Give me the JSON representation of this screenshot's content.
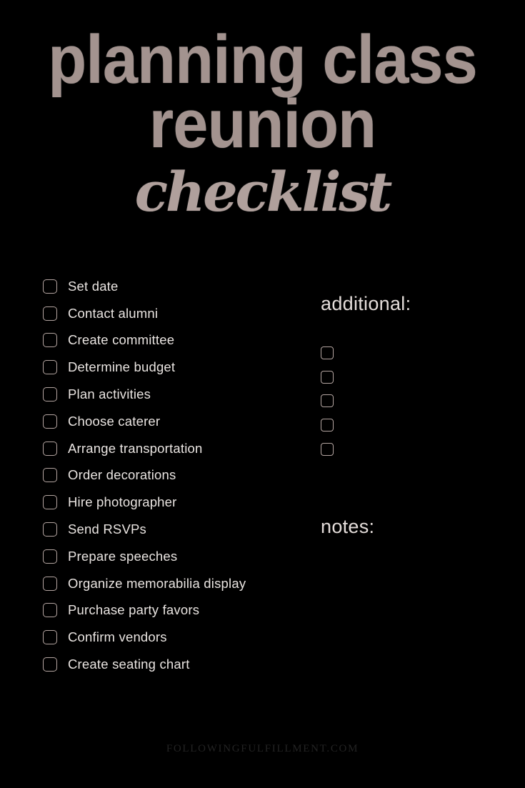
{
  "background_color": "#000000",
  "accent_color": "#a3938f",
  "header": {
    "title_line_1": "planning class",
    "title_line_2": "reunion",
    "script_word": "checklist"
  },
  "checklist": {
    "items": [
      {
        "label": "Set date",
        "checked": false
      },
      {
        "label": "Contact alumni",
        "checked": false
      },
      {
        "label": "Create committee",
        "checked": false
      },
      {
        "label": "Determine budget",
        "checked": false
      },
      {
        "label": "Plan activities",
        "checked": false
      },
      {
        "label": "Choose caterer",
        "checked": false
      },
      {
        "label": "Arrange transportation",
        "checked": false
      },
      {
        "label": "Order decorations",
        "checked": false
      },
      {
        "label": "Hire photographer",
        "checked": false
      },
      {
        "label": "Send RSVPs",
        "checked": false
      },
      {
        "label": "Prepare speeches",
        "checked": false
      },
      {
        "label": "Organize memorabilia display",
        "checked": false
      },
      {
        "label": "Purchase party favors",
        "checked": false
      },
      {
        "label": "Confirm vendors",
        "checked": false
      },
      {
        "label": "Create seating chart",
        "checked": false
      }
    ]
  },
  "additional": {
    "heading": "additional:",
    "blank_rows": [
      {
        "value": ""
      },
      {
        "value": ""
      },
      {
        "value": ""
      },
      {
        "value": ""
      },
      {
        "value": ""
      }
    ]
  },
  "notes": {
    "heading": "notes:",
    "value": ""
  },
  "footer": {
    "watermark": "FOLLOWINGFULFILLMENT.COM"
  }
}
